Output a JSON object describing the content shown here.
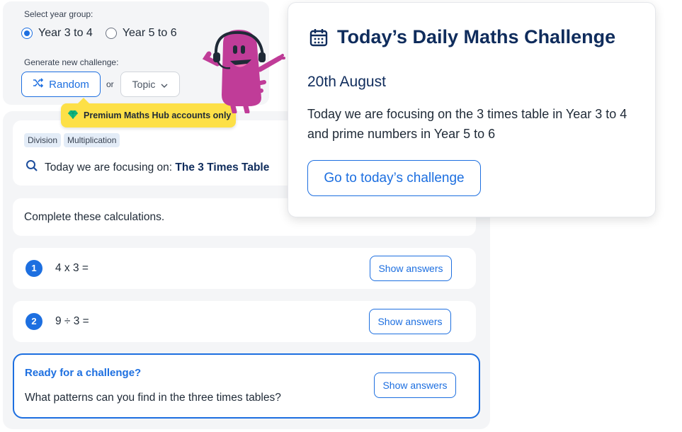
{
  "settings": {
    "year_group_label": "Select year group:",
    "year_options": [
      {
        "label": "Year 3 to 4",
        "selected": true
      },
      {
        "label": "Year 5 to 6",
        "selected": false
      }
    ],
    "generate_label": "Generate new challenge:",
    "random_label": "Random",
    "or_label": "or",
    "topic_label": "Topic",
    "premium_label": "Premium Maths Hub accounts only"
  },
  "challenge": {
    "tags": [
      "Division",
      "Multiplication"
    ],
    "focus_prefix": "Today we are focusing on:",
    "focus_topic": "The 3 Times Table",
    "instructions": "Complete these calculations.",
    "questions": [
      {
        "number": "1",
        "text": "4 x 3 =",
        "answer_label": "Show answers"
      },
      {
        "number": "2",
        "text": "9 ÷ 3 =",
        "answer_label": "Show answers"
      }
    ],
    "extra": {
      "title": "Ready for a challenge?",
      "question": "What patterns can you find in the three times tables?",
      "answer_label": "Show answers"
    }
  },
  "popup": {
    "title": "Today’s Daily Maths Challenge",
    "date": "20th August",
    "description": "Today we are focusing on the 3 times table in Year 3 to 4 and prime numbers in Year 5 to 6",
    "button_label": "Go to today’s challenge"
  },
  "colors": {
    "accent": "#1d6fe0",
    "navy": "#0f2c5c",
    "premium": "#fde047",
    "mascot": "#c03c98"
  },
  "icons": [
    "shuffle-icon",
    "chevron-down-icon",
    "gem-icon",
    "search-icon",
    "calendar-icon"
  ]
}
